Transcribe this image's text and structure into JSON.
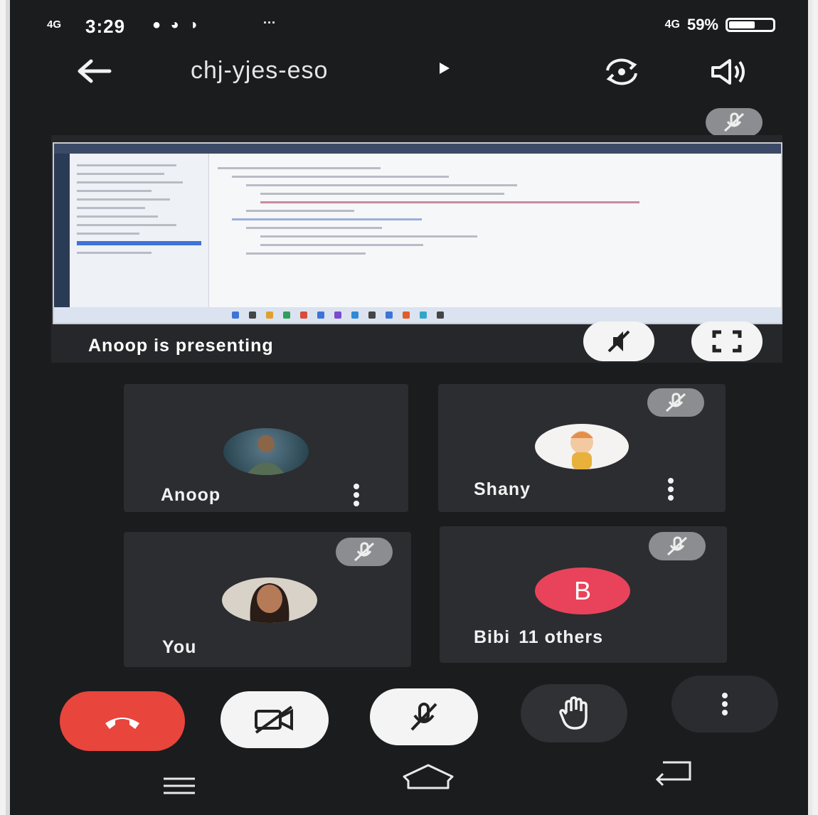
{
  "status_bar": {
    "network_left": "4G",
    "time": "3:29",
    "notification_icons": "● ◕ ◑",
    "more": "···",
    "network_right": "4G",
    "battery": "59%"
  },
  "header": {
    "meeting_code": "chj-yjes-eso",
    "icons": [
      "back-arrow-icon",
      "switch-camera-icon",
      "speaker-icon"
    ]
  },
  "presentation": {
    "presenting_label": "Anoop is presenting",
    "buttons": [
      "mute-presentation-audio",
      "fullscreen"
    ]
  },
  "participants": [
    {
      "name": "Anoop",
      "avatar": "photo",
      "muted": false
    },
    {
      "name": "Shany",
      "avatar": "photo",
      "muted": true
    },
    {
      "name": "You",
      "avatar": "photo",
      "muted": true
    },
    {
      "name": "Bibi",
      "avatar_letter": "B",
      "others": "11 others",
      "muted": true
    }
  ],
  "controls": [
    "end-call",
    "camera-off",
    "mic-off",
    "raise-hand",
    "more-options"
  ],
  "colors": {
    "background": "#1b1c1e",
    "tile": "#2b2d31",
    "end_call": "#e8453c",
    "avatar_b": "#e8435a"
  }
}
